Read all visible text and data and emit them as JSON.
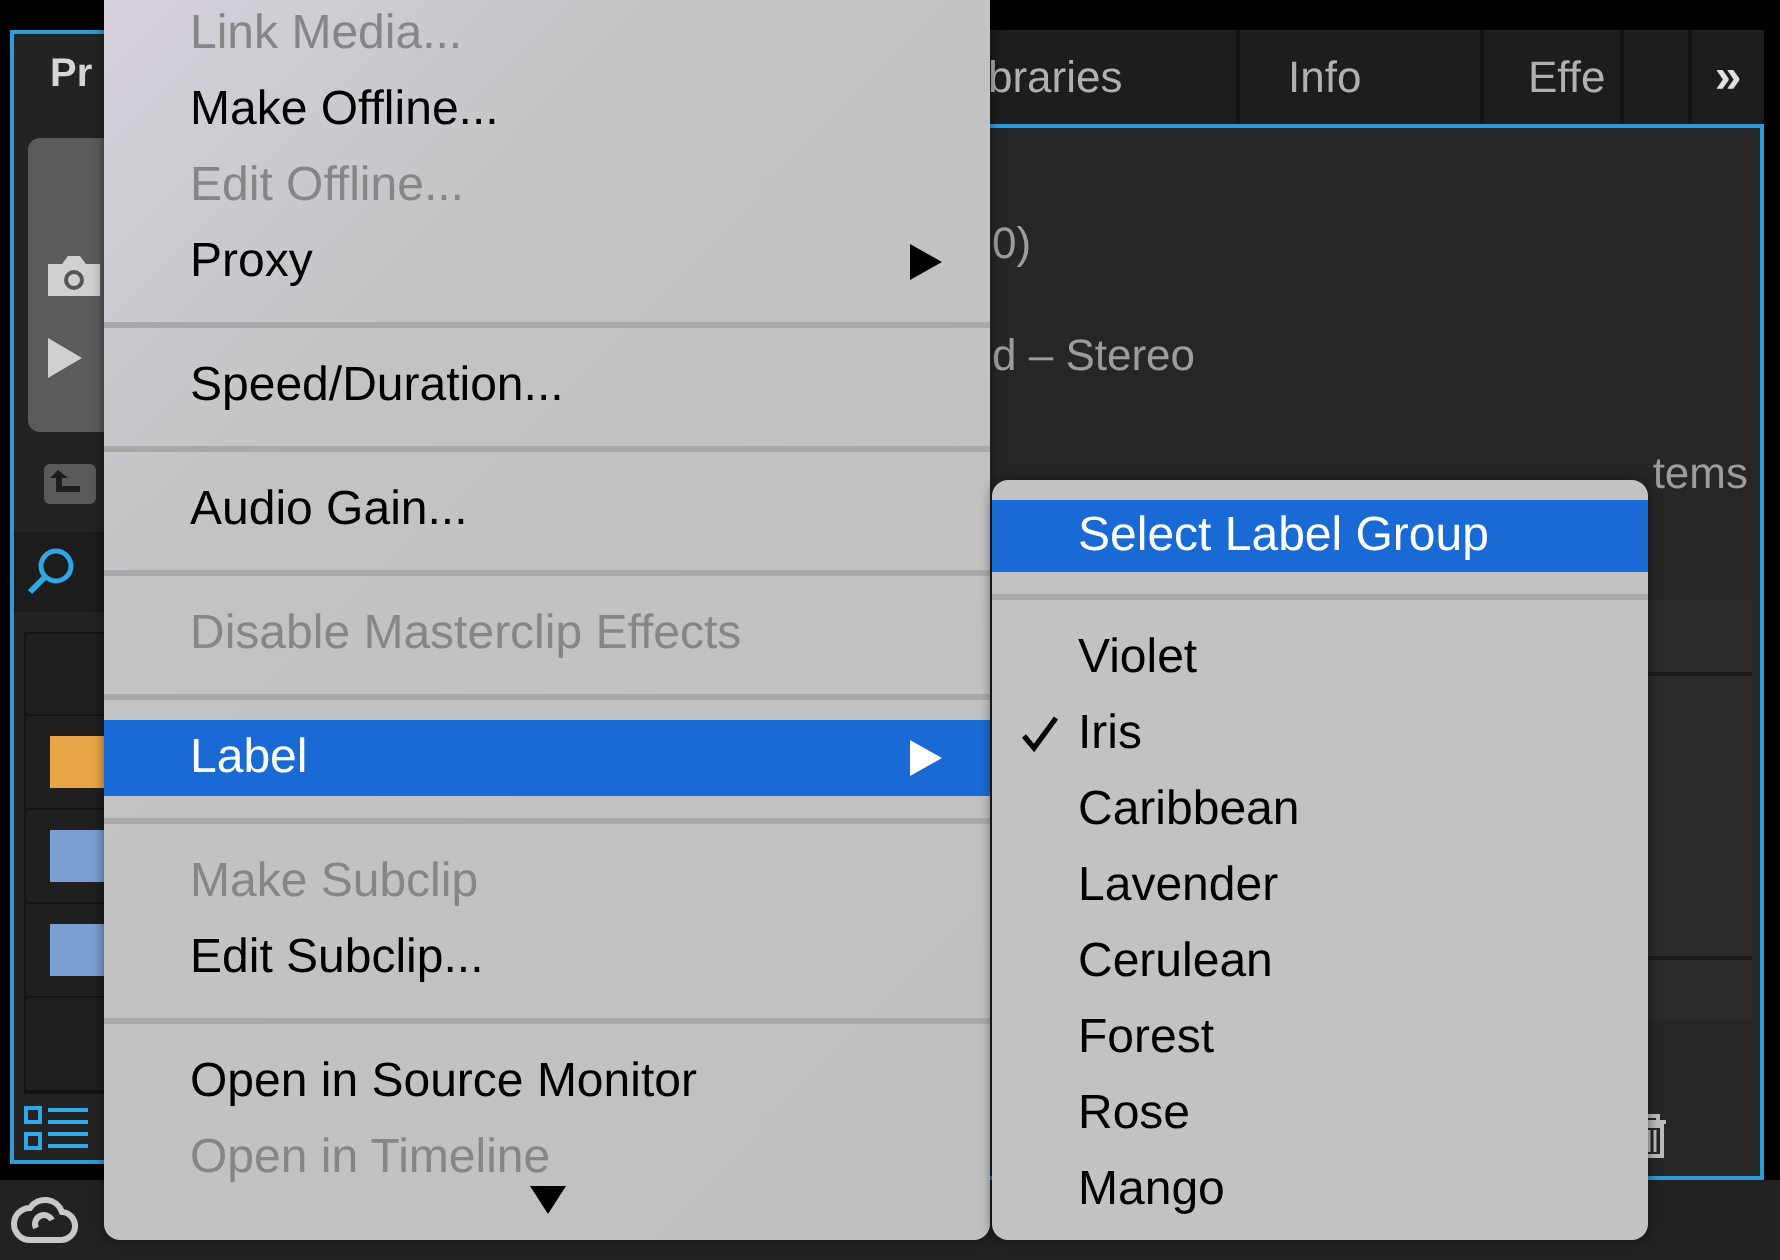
{
  "left_panel": {
    "tab": "Pr",
    "rows": [
      {
        "color": "#e9a648"
      },
      {
        "color": "#7b9fd2"
      },
      {
        "color": "#7b9fd2"
      }
    ]
  },
  "right_panel": {
    "tabs": [
      {
        "label": "braries",
        "selected": false
      },
      {
        "label": "Info",
        "selected": false
      },
      {
        "label": "Effe",
        "selected": false
      }
    ],
    "overflow_button": "»",
    "lines": [
      "0)",
      "d – Stereo"
    ],
    "item_count": "tems"
  },
  "context_menu": {
    "items": [
      {
        "kind": "item",
        "label": "Link Media...",
        "disabled": true,
        "has_submenu": false,
        "selected": false
      },
      {
        "kind": "item",
        "label": "Make Offline...",
        "disabled": false,
        "has_submenu": false,
        "selected": false
      },
      {
        "kind": "item",
        "label": "Edit Offline...",
        "disabled": true,
        "has_submenu": false,
        "selected": false
      },
      {
        "kind": "item",
        "label": "Proxy",
        "disabled": false,
        "has_submenu": true,
        "selected": false
      },
      {
        "kind": "separator"
      },
      {
        "kind": "item",
        "label": "Speed/Duration...",
        "disabled": false,
        "has_submenu": false,
        "selected": false
      },
      {
        "kind": "separator"
      },
      {
        "kind": "item",
        "label": "Audio Gain...",
        "disabled": false,
        "has_submenu": false,
        "selected": false
      },
      {
        "kind": "separator"
      },
      {
        "kind": "item",
        "label": "Disable Masterclip Effects",
        "disabled": true,
        "has_submenu": false,
        "selected": false
      },
      {
        "kind": "separator"
      },
      {
        "kind": "item",
        "label": "Label",
        "disabled": false,
        "has_submenu": true,
        "selected": true
      },
      {
        "kind": "separator"
      },
      {
        "kind": "item",
        "label": "Make Subclip",
        "disabled": true,
        "has_submenu": false,
        "selected": false
      },
      {
        "kind": "item",
        "label": "Edit Subclip...",
        "disabled": false,
        "has_submenu": false,
        "selected": false
      },
      {
        "kind": "separator"
      },
      {
        "kind": "item",
        "label": "Open in Source Monitor",
        "disabled": false,
        "has_submenu": false,
        "selected": false
      },
      {
        "kind": "item",
        "label": "Open in Timeline",
        "disabled": true,
        "has_submenu": false,
        "selected": false
      }
    ]
  },
  "submenu": {
    "header": {
      "label": "Select Label Group",
      "selected": true
    },
    "items": [
      {
        "label": "Violet",
        "checked": false
      },
      {
        "label": "Iris",
        "checked": true
      },
      {
        "label": "Caribbean",
        "checked": false
      },
      {
        "label": "Lavender",
        "checked": false
      },
      {
        "label": "Cerulean",
        "checked": false
      },
      {
        "label": "Forest",
        "checked": false
      },
      {
        "label": "Rose",
        "checked": false
      },
      {
        "label": "Mango",
        "checked": false
      }
    ]
  }
}
